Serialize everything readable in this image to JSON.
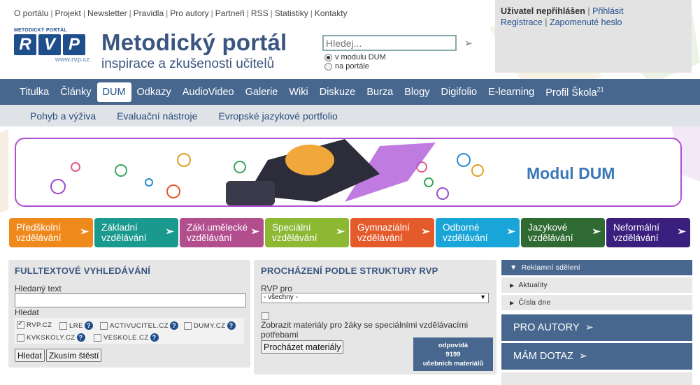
{
  "topnav": [
    "O portálu",
    "Projekt",
    "Newsletter",
    "Pravidla",
    "Pro autory",
    "Partneři",
    "RSS",
    "Statistiky",
    "Kontakty"
  ],
  "logo": {
    "small": "METODICKÝ PORTÁL",
    "letters": [
      "R",
      "V",
      "P"
    ],
    "url": "www.rvp.cz"
  },
  "site": {
    "title": "Metodický portál",
    "subtitle": "inspirace a zkušenosti učitelů"
  },
  "search": {
    "placeholder": "Hledej...",
    "opt1": "v modulu DUM",
    "opt2": "na portále"
  },
  "user": {
    "status": "Uživatel nepřihlášen",
    "login": "Přihlásit",
    "register": "Registrace",
    "forgot": "Zapomenuté heslo"
  },
  "mainnav": [
    "Titulka",
    "Články",
    "DUM",
    "Odkazy",
    "AudioVideo",
    "Galerie",
    "Wiki",
    "Diskuze",
    "Burza",
    "Blogy",
    "Digifolio",
    "E-learning",
    "Profil Škola"
  ],
  "mainnav_sup": "21",
  "subnav": [
    "Pohyb a výživa",
    "Evaluační nástroje",
    "Evropské jazykové portfolio"
  ],
  "banner": {
    "title": "Modul DUM"
  },
  "categories": [
    {
      "l1": "Předškolní",
      "l2": "vzdělávání",
      "color": "#f0891c"
    },
    {
      "l1": "Základní",
      "l2": "vzdělávání",
      "color": "#1a9a8e"
    },
    {
      "l1": "Zákl.umělecké",
      "l2": "vzdělávání",
      "color": "#b24e8e"
    },
    {
      "l1": "Speciální",
      "l2": "vzdělávání",
      "color": "#8cb832"
    },
    {
      "l1": "Gymnaziální",
      "l2": "vzdělávání",
      "color": "#e55a2b"
    },
    {
      "l1": "Odborné",
      "l2": "vzdělávání",
      "color": "#1aa5d8"
    },
    {
      "l1": "Jazykové",
      "l2": "vzdělávání",
      "color": "#2e6a32"
    },
    {
      "l1": "Neformální",
      "l2": "vzdělávání",
      "color": "#3a1f7e"
    }
  ],
  "fulltext": {
    "title": "FULLTEXTOVÉ VYHLEDÁVÁNÍ",
    "label_query": "Hledaný text",
    "label_where": "Hledat",
    "sources": [
      "RVP.CZ",
      "LRE",
      "ACTIVUCITEL.CZ",
      "DUMY.CZ",
      "KVKSKOLY.CZ",
      "VESKOLE.CZ"
    ],
    "btn_search": "Hledat",
    "btn_lucky": "Zkusím štěstí"
  },
  "structure": {
    "title": "PROCHÁZENÍ PODLE STRUKTURY RVP",
    "label": "RVP pro",
    "select": "- všechny -",
    "special": "Zobrazit materiály pro žáky se speciálními vzdělávacími potřebami",
    "btn": "Procházet materiály",
    "count_pre": "odpovídá",
    "count": "9199",
    "count_post": "učebních materiálů"
  },
  "sidebar": {
    "items": [
      "Reklamní sdělení",
      "Aktuality",
      "Čísla dne"
    ],
    "btn1": "PRO AUTORY",
    "btn2": "MÁM DOTAZ"
  }
}
